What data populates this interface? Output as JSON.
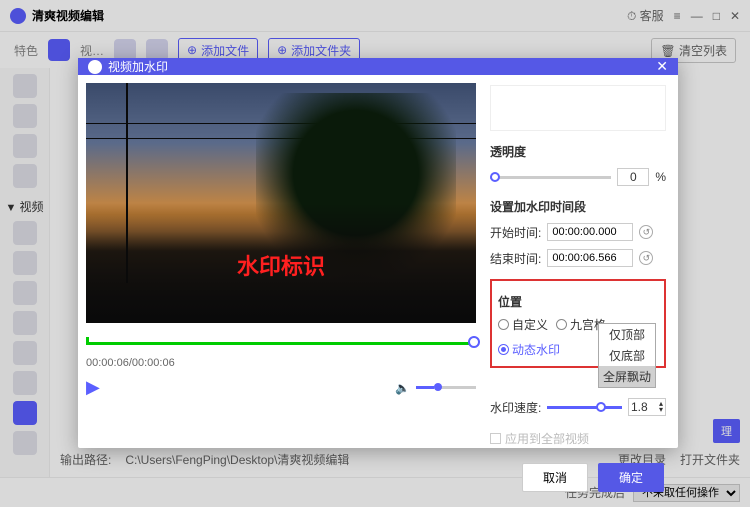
{
  "app": {
    "title": "清爽视频编辑",
    "support": "客服"
  },
  "toolbar": {
    "tab_special": "特色",
    "tab_video": "视…",
    "add_file": "添加文件",
    "add_folder": "添加文件夹",
    "clear_list": "清空列表"
  },
  "sidebar": {
    "section_label": "视频"
  },
  "modal": {
    "title": "视频加水印",
    "watermark_text": "水印标识",
    "time_display": "00:00:06/00:00:06",
    "opacity_label": "透明度",
    "opacity_value": "0",
    "opacity_unit": "%",
    "time_section": "设置加水印时间段",
    "start_label": "开始时间:",
    "start_value": "00:00:00.000",
    "end_label": "结束时间:",
    "end_value": "00:00:06.566",
    "position_label": "位置",
    "pos_custom": "自定义",
    "pos_grid": "九宫格",
    "pos_dynamic": "动态水印",
    "dd_top": "仅顶部",
    "dd_bottom": "仅底部",
    "dd_full": "全屏飘动",
    "speed_label": "水印速度:",
    "speed_value": "1.8",
    "apply_all": "应用到全部视频",
    "cancel": "取消",
    "confirm": "确定"
  },
  "output": {
    "label": "输出路径:",
    "path": "C:\\Users\\FengPing\\Desktop\\清爽视频编辑",
    "change_dir": "更改目录",
    "open_folder": "打开文件夹",
    "manage": "理"
  },
  "footer": {
    "after_done": "任务完成后",
    "action": "不采取任何操作"
  }
}
